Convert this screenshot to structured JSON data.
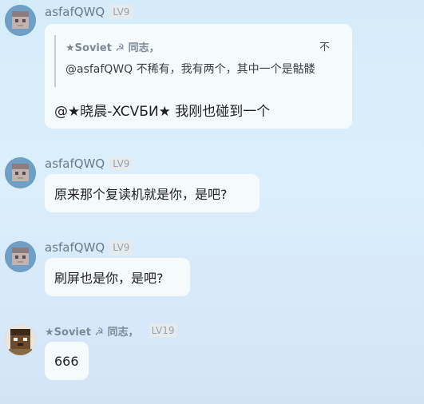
{
  "messages": [
    {
      "sender": "asfafQWQ",
      "level": "LV9",
      "quote": {
        "author": "★Soviet ☭ 同志，",
        "close": "不",
        "text": "@asfafQWQ 不稀有，我有两个，其中一个是骷髅"
      },
      "text": "@★晓晨-XCVБИ★ 我刚也碰到一个"
    },
    {
      "sender": "asfafQWQ",
      "level": "LV9",
      "text": "原来那个复读机就是你，是吧?"
    },
    {
      "sender": "asfafQWQ",
      "level": "LV9",
      "text": "刷屏也是你，是吧?"
    },
    {
      "sender": "★Soviet ☭ 同志，",
      "level": "LV19",
      "text": "666"
    }
  ],
  "colors": {
    "bubble": "#f5fafd",
    "background_top": "#d4ecf9",
    "name": "#6b7a86"
  }
}
